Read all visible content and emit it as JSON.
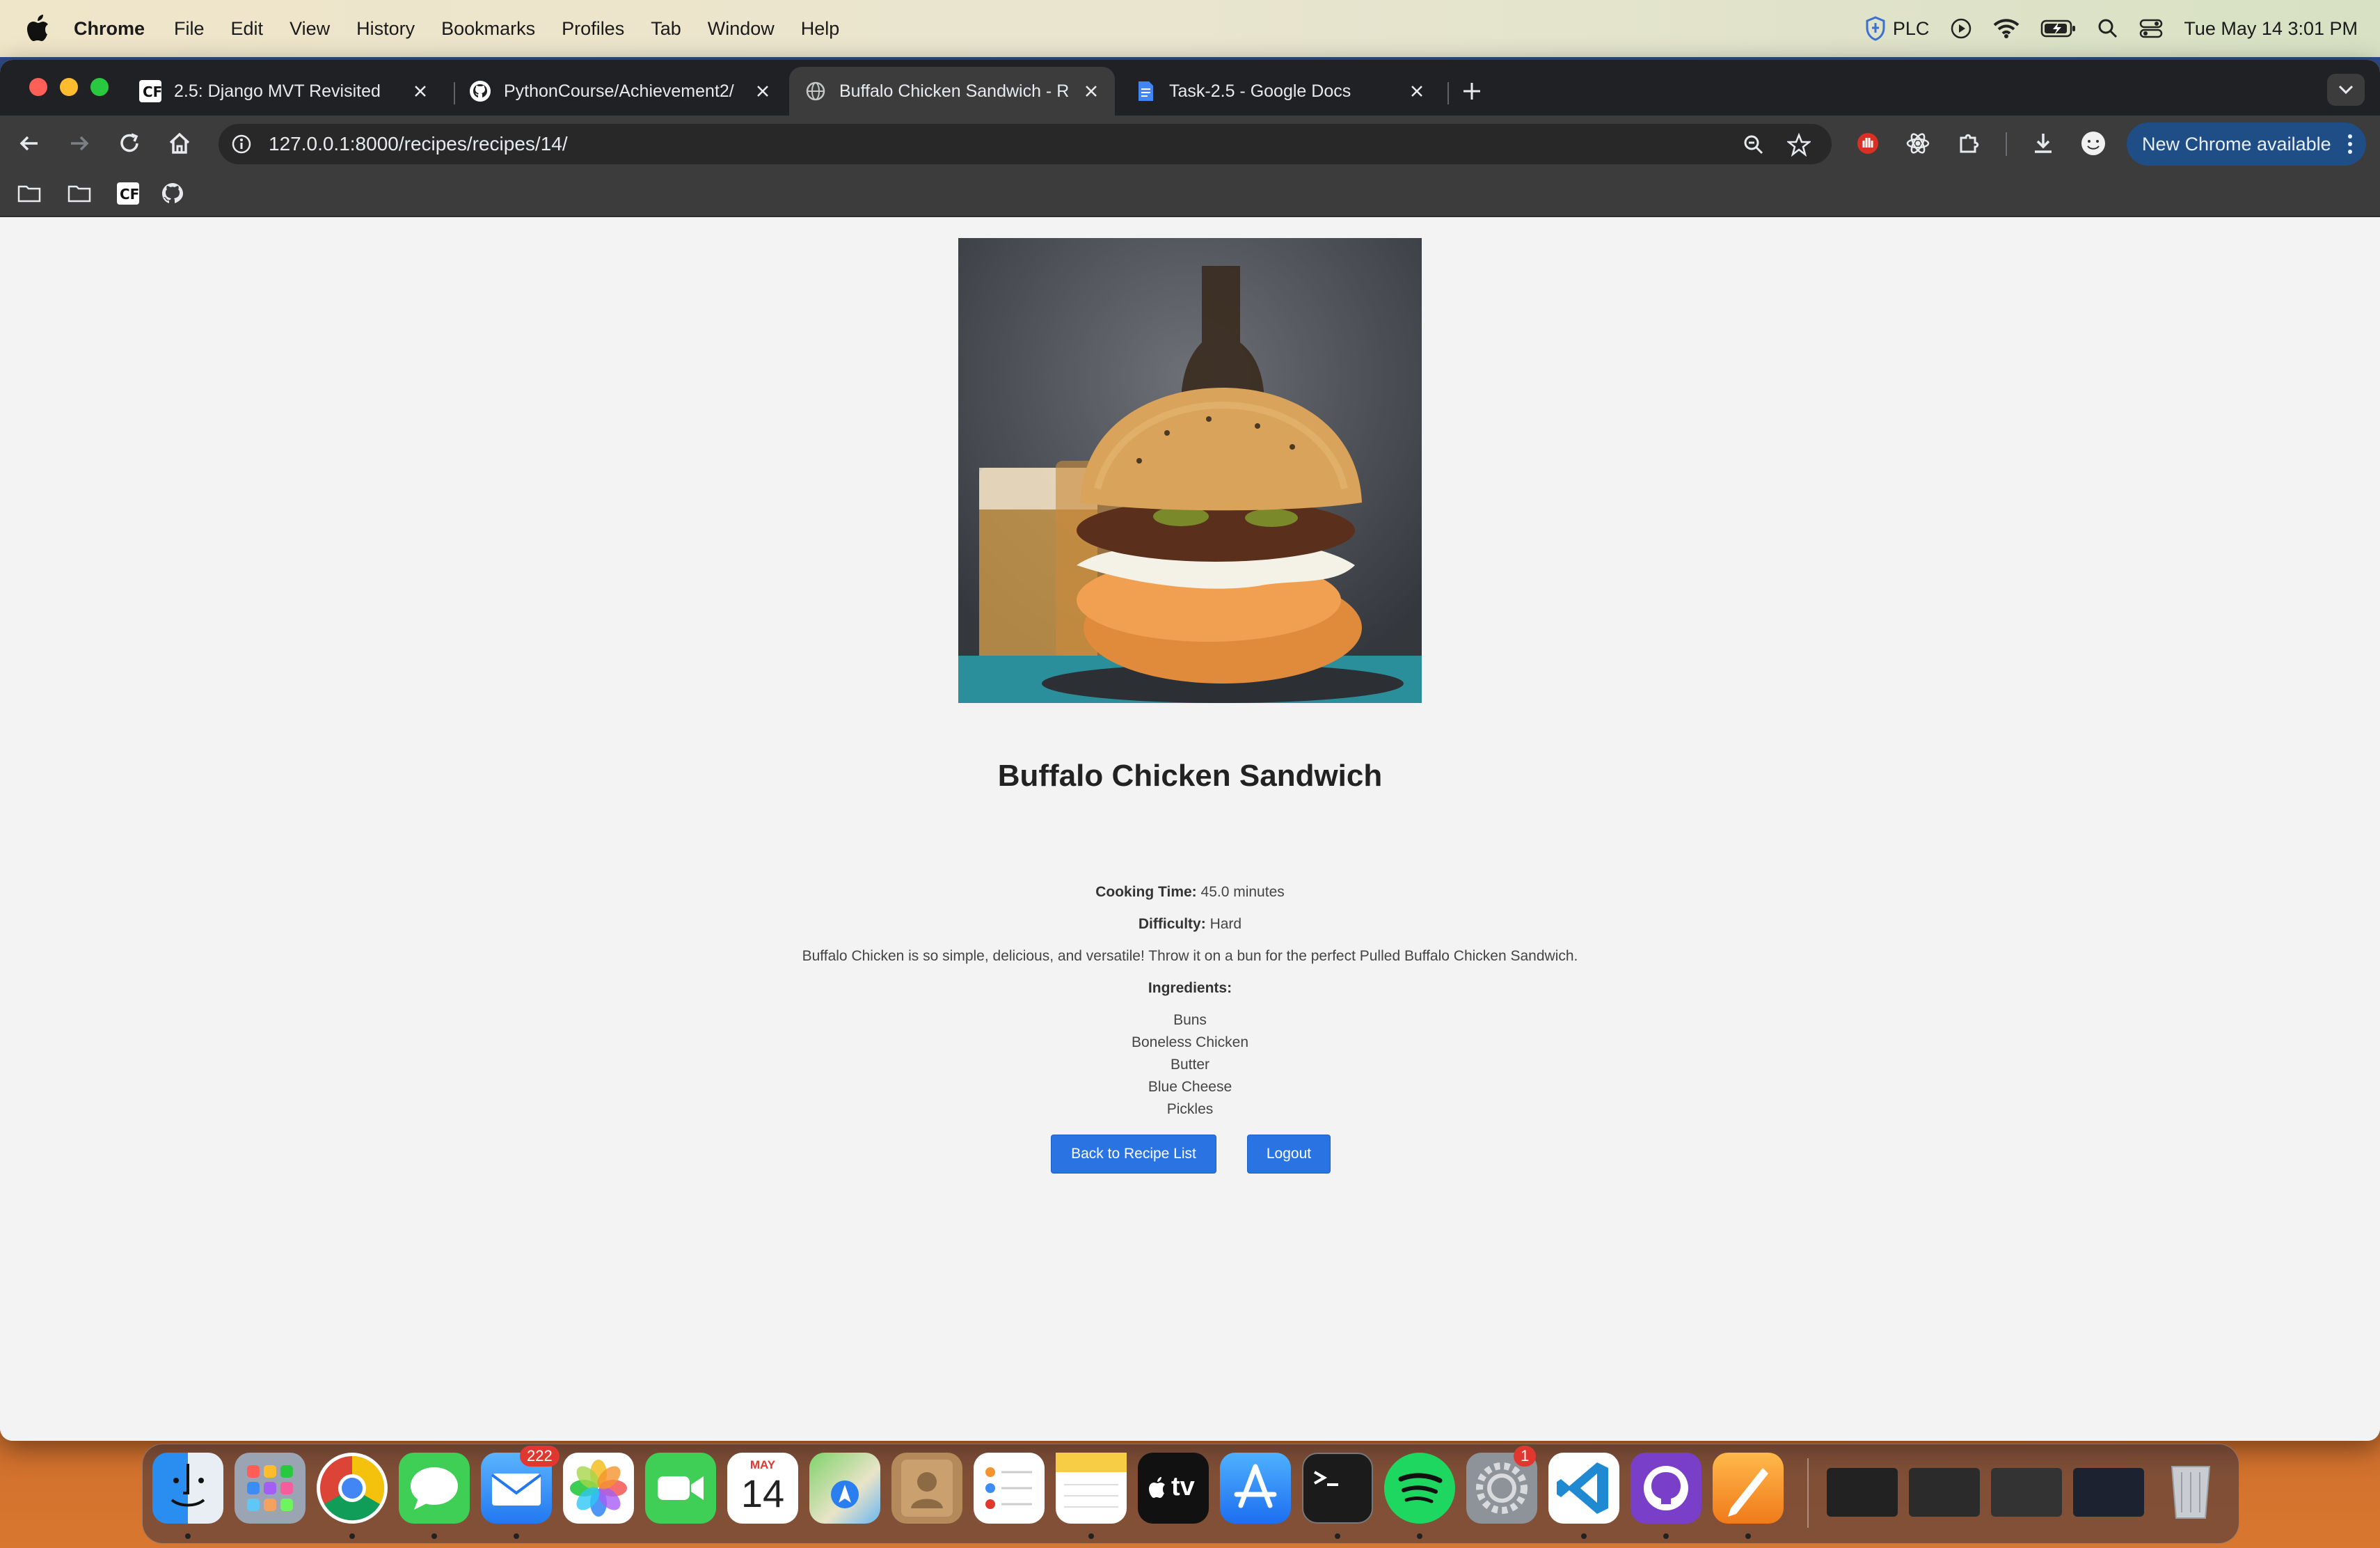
{
  "menubar": {
    "app_name": "Chrome",
    "items": [
      "File",
      "Edit",
      "View",
      "History",
      "Bookmarks",
      "Profiles",
      "Tab",
      "Window",
      "Help"
    ],
    "vpn_label": "PLC",
    "datetime": "Tue May 14  3:01 PM"
  },
  "tabs": [
    {
      "title": "2.5: Django MVT Revisited",
      "icon": "careerfoundry-icon"
    },
    {
      "title": "PythonCourse/Achievement2/",
      "icon": "github-icon"
    },
    {
      "title": "Buffalo Chicken Sandwich - R",
      "icon": "globe-icon",
      "active": true
    },
    {
      "title": "Task-2.5 - Google Docs",
      "icon": "google-docs-icon"
    }
  ],
  "address_bar": {
    "url": "127.0.0.1:8000/recipes/recipes/14/"
  },
  "update_button_label": "New Chrome available",
  "recipe": {
    "title": "Buffalo Chicken Sandwich",
    "cooking_time_label": "Cooking Time:",
    "cooking_time_value": "45.0 minutes",
    "difficulty_label": "Difficulty:",
    "difficulty_value": "Hard",
    "description": "Buffalo Chicken is so simple, delicious, and versatile! Throw it on a bun for the perfect Pulled Buffalo Chicken Sandwich.",
    "ingredients_label": "Ingredients:",
    "ingredients": [
      "Buns",
      "Boneless Chicken",
      "Butter",
      "Blue Cheese",
      "Pickles"
    ],
    "back_button": "Back to Recipe List",
    "logout_button": "Logout"
  },
  "dock": {
    "mail_badge": "222",
    "calendar_month": "MAY",
    "calendar_day": "14",
    "settings_badge": "1",
    "tv_label": "tv"
  },
  "colors": {
    "accent_button": "#2a73e3",
    "update_pill": "#1f4e86",
    "page_background": "#f3f3f3"
  }
}
